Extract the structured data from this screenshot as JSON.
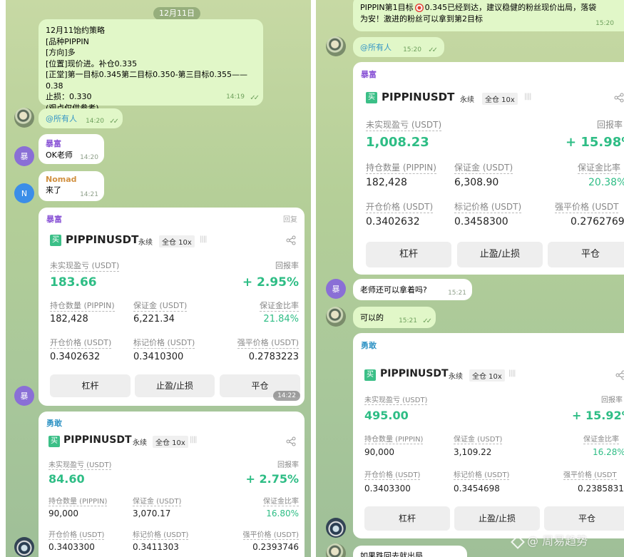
{
  "left": {
    "date": "12月11日",
    "strategy": {
      "lines": [
        "12月11饴约策略",
        "[品种PIPPIN",
        "[方向]多",
        "[位置]现价进。补仓0.335",
        "[正堂]第一目标0.345第二目标0.350-第三目标0.355——0.38",
        "止损：0.330",
        "(观点仅供参考)."
      ],
      "time": "14:19"
    },
    "all_msg": {
      "text": "@所有人",
      "time": "14:20"
    },
    "msg1": {
      "sender": "暴富",
      "text": "OK老师",
      "time": "14:20",
      "avatar": "暴"
    },
    "msg2": {
      "sender": "Nomad",
      "text": "来了",
      "time": "14:21",
      "avatar": "N"
    },
    "card1": {
      "sender": "暴富",
      "reply": "回复",
      "avatar": "暴",
      "time": "14:22",
      "buy": "买",
      "symbol": "PIPPINUSDT",
      "tag1": "永续",
      "tag2": "全仓 10x",
      "bars": "||||",
      "pnl_label": "未实现盈亏 (USDT)",
      "pnl": "183.66",
      "roe_label": "回报率",
      "roe": "+ 2.95%",
      "qty_label": "持仓数量 (PIPPIN)",
      "qty": "182,428",
      "margin_label": "保证金 (USDT)",
      "margin": "6,221.34",
      "mratio_label": "保证金比率",
      "mratio": "21.84%",
      "entry_label": "开仓价格 (USDT)",
      "entry": "0.3402632",
      "mark_label": "标记价格 (USDT)",
      "mark": "0.3410300",
      "liq_label": "强平价格 (USDT)",
      "liq": "0.2783223",
      "btn1": "杠杆",
      "btn2": "止盈/止损",
      "btn3": "平仓"
    },
    "card2": {
      "sender": "勇敢",
      "buy": "买",
      "symbol": "PIPPINUSDT",
      "tag1": "永续",
      "tag2": "全仓 10x",
      "bars": "||||",
      "pnl_label": "未实现盈亏 (USDT)",
      "pnl": "84.60",
      "roe_label": "回报率",
      "roe": "+ 2.75%",
      "qty_label": "持仓数量 (PIPPIN)",
      "qty": "90,000",
      "margin_label": "保证金 (USDT)",
      "margin": "3,070.17",
      "mratio_label": "保证金比率",
      "mratio": "16.80%",
      "entry_label": "开仓价格 (USDT)",
      "entry": "0.3403300",
      "mark_label": "标记价格 (USDT)",
      "mark": "0.3411303",
      "liq_label": "强平价格 (USDT)",
      "liq": "0.2393746"
    }
  },
  "right": {
    "top_msg": {
      "text1": "PIPPIN第1目标",
      "text2": "0.345已经到达，建议稳健的粉丝现价出局，落袋",
      "text3": "为安！激进的粉丝可以拿到第2目标",
      "time": "15:20"
    },
    "all_msg": {
      "text": "@所有人",
      "time": "15:20"
    },
    "card1": {
      "sender": "暴富",
      "buy": "买",
      "symbol": "PIPPINUSDT",
      "tag1": "永续",
      "tag2": "全仓 10x",
      "bars": "||||",
      "pnl_label": "未实现盈亏 (USDT)",
      "pnl": "1,008.23",
      "roe_label": "回报率",
      "roe": "+ 15.98%",
      "qty_label": "持仓数量 (PIPPIN)",
      "qty": "182,428",
      "margin_label": "保证金 (USDT)",
      "margin": "6,308.90",
      "mratio_label": "保证金比率",
      "mratio": "20.38%",
      "entry_label": "开仓价格 (USDT)",
      "entry": "0.3402632",
      "mark_label": "标记价格 (USDT)",
      "mark": "0.3458300",
      "liq_label": "强平价格 (USDT",
      "liq": "0.2762769",
      "btn1": "杠杆",
      "btn2": "止盈/止损",
      "btn3": "平仓"
    },
    "msg1": {
      "text": "老师还可以拿着吗?",
      "time": "15:21",
      "avatar": "暴"
    },
    "msg2": {
      "text": "可以的",
      "time": "15:21"
    },
    "card2": {
      "sender": "勇敢",
      "buy": "买",
      "symbol": "PIPPINUSDT",
      "tag1": "永续",
      "tag2": "全仓 10x",
      "bars": "||||",
      "pnl_label": "未实现盈亏 (USDT)",
      "pnl": "495.00",
      "roe_label": "回报率",
      "roe": "+ 15.92%",
      "qty_label": "持仓数量 (PIPPIN)",
      "qty": "90,000",
      "margin_label": "保证金 (USDT)",
      "margin": "3,109.22",
      "mratio_label": "保证金比率",
      "mratio": "16.28%",
      "entry_label": "开仓价格 (USDT)",
      "entry": "0.3403300",
      "mark_label": "标记价格 (USDT)",
      "mark": "0.3454698",
      "liq_label": "强平价格 (USDT",
      "liq": "0.2385831",
      "btn1": "杠杆",
      "btn2": "止盈/止损",
      "btn3": "平仓"
    },
    "bottom_msg": {
      "text": "如果跌回去就出局"
    },
    "watermark": "@ 周易趋势"
  }
}
